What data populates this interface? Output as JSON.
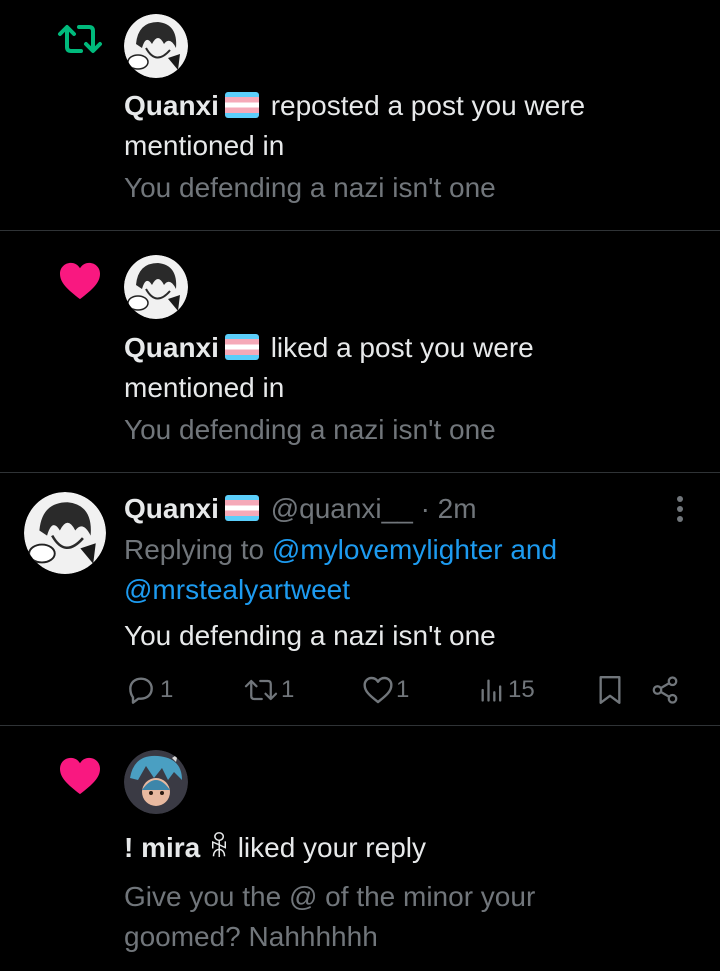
{
  "notifications": [
    {
      "type": "repost",
      "icon": "repost-icon",
      "icon_color": "#00ba7c",
      "user": "Quanxi",
      "action_text": "reposted a post you were",
      "action_text_2": "mentioned in",
      "snippet": "You defending a nazi isn't one"
    },
    {
      "type": "like",
      "icon": "heart-icon",
      "icon_color": "#f91880",
      "user": "Quanxi",
      "action_text": "liked a post you were",
      "action_text_2": "mentioned in",
      "snippet": "You defending a nazi isn't one"
    },
    {
      "type": "like",
      "icon": "heart-icon",
      "icon_color": "#f91880",
      "user": "! mira",
      "user_glyph": "ꆜ",
      "action_text": "liked your reply",
      "snippet_line1": "Give you the @ of the minor your",
      "snippet_line2": "goomed? Nahhhhhh"
    }
  ],
  "reply_post": {
    "user": "Quanxi",
    "handle": "@quanxi__",
    "time": "· 2m",
    "replying_label": "Replying to",
    "mention1": "@mylovemylighter",
    "and_label": "and",
    "mention2": "@mrstealyartweet",
    "text": "You defending a nazi isn't one",
    "stats": {
      "replies": "1",
      "reposts": "1",
      "likes": "1",
      "views": "15"
    }
  },
  "colors": {
    "background": "#000000",
    "text": "#e7e9ea",
    "muted": "#71767b",
    "link": "#1d9bf0",
    "divider": "#2f3336"
  }
}
